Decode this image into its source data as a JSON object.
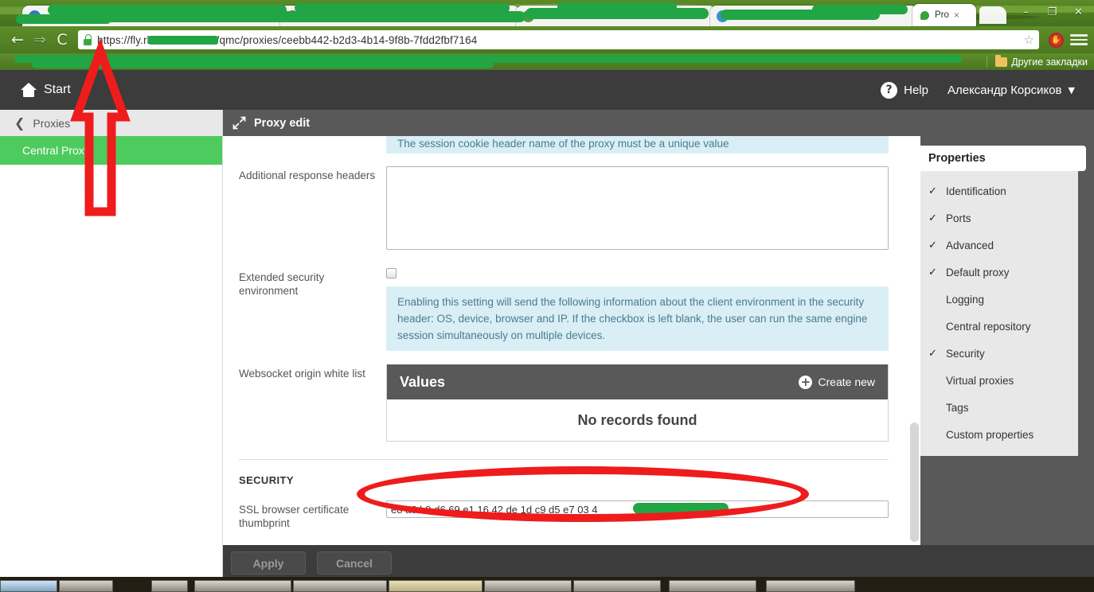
{
  "browser": {
    "tabs": [
      {
        "title": "",
        "redacted": true,
        "active": false
      },
      {
        "title": "",
        "redacted": true,
        "active": false
      },
      {
        "title": "Pro",
        "icon": "skype-icon",
        "active": true,
        "close_label": "×"
      }
    ],
    "nav": {
      "back_icon": "←",
      "forward_icon": "⇒",
      "reload_icon": "C",
      "lock_icon": "lock-icon",
      "url_prefix": "https://fly.rl",
      "url_redacted": "████████",
      "url_suffix": "/qmc/proxies/ceebb442-b2d3-4b14-9f8b-7fdd2fbf7164",
      "star_icon": "☆",
      "adblock_icon": "✋",
      "menu_icon": "hamburger-menu-icon"
    },
    "bookmarks": {
      "other_label": "Другие закладки",
      "folder_icon": "folder-icon"
    },
    "window_controls": {
      "minimize": "–",
      "restore": "❐",
      "close": "✕"
    }
  },
  "app": {
    "header": {
      "start_label": "Start",
      "home_icon": "home-icon",
      "help_label": "Help",
      "help_icon": "question-mark-icon",
      "user_name": "Александр Корсиков",
      "user_caret": "▼"
    },
    "sidebar": {
      "breadcrumb_label": "Proxies",
      "back_icon": "❮",
      "items": [
        {
          "label": "Central Proxy",
          "active": true
        }
      ]
    },
    "content": {
      "title": "Proxy edit",
      "title_icon": "collapse-arrows-icon",
      "cookie_hint": "The session cookie header name of the proxy must be a unique value",
      "fields": {
        "additional_response_headers": {
          "label": "Additional response headers",
          "value": "",
          "placeholder": ""
        },
        "extended_security_environment": {
          "label": "Extended security environment",
          "checked": false,
          "hint": "Enabling this setting will send the following information about the client environment in the security header: OS, device, browser and IP. If the checkbox is left blank, the user can run the same engine session simultaneously on multiple devices."
        },
        "websocket_origin_white_list": {
          "label": "Websocket origin white list",
          "panel_title": "Values",
          "create_new_label": "Create new",
          "create_new_icon": "plus-circle-icon",
          "empty_text": "No records found"
        }
      },
      "security_section": {
        "title": "SECURITY",
        "ssl_thumbprint": {
          "label": "SSL browser certificate thumbprint",
          "value": "e8 a6 b9 d6 69 e1 16 42 de 1d c9 d5 e7 03 4",
          "redacted_tail": true
        }
      }
    },
    "properties": {
      "title": "Properties",
      "check_icon": "✓",
      "items": [
        {
          "label": "Identification",
          "checked": true
        },
        {
          "label": "Ports",
          "checked": true
        },
        {
          "label": "Advanced",
          "checked": true
        },
        {
          "label": "Default proxy",
          "checked": true
        },
        {
          "label": "Logging",
          "checked": false
        },
        {
          "label": "Central repository",
          "checked": false
        },
        {
          "label": "Security",
          "checked": true
        },
        {
          "label": "Virtual proxies",
          "checked": false
        },
        {
          "label": "Tags",
          "checked": false
        },
        {
          "label": "Custom properties",
          "checked": false
        }
      ]
    },
    "footer": {
      "apply_label": "Apply",
      "cancel_label": "Cancel"
    }
  },
  "annotations": {
    "arrow_color": "#ee1c1c",
    "ellipse_color": "#ee1c1c",
    "redaction_color": "#22a544",
    "arrow_target": "url-bar",
    "ellipse_target": "ssl-thumbprint-field"
  },
  "colors": {
    "accent_green": "#4ecb5e",
    "header_dark": "#3c3c3c",
    "panel_dark": "#595959",
    "info_blue": "#d9eef5",
    "browser_green": "#5e8d2a"
  }
}
